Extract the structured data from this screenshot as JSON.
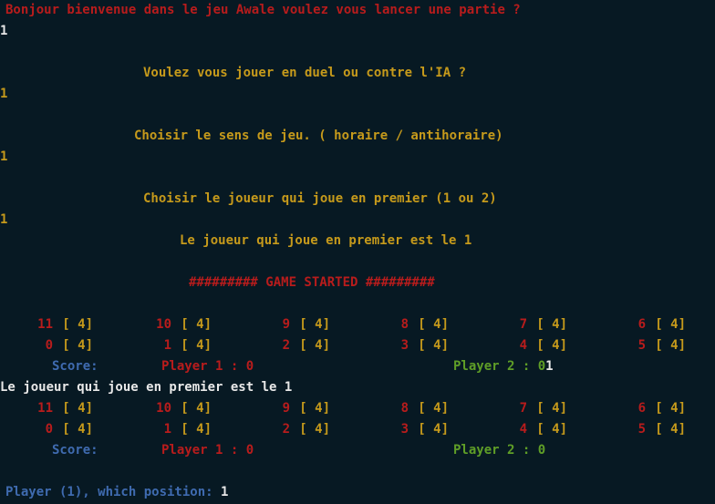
{
  "colors": {
    "background": "#071923",
    "red": "#b81c1c",
    "gold": "#c69a1b",
    "white": "#e8e8e8",
    "blue": "#3f6bb0",
    "green": "#5f9e27"
  },
  "intro": {
    "welcome_question": "Bonjour bienvenue dans le jeu Awale voulez vous lancer une partie ?",
    "welcome_answer": "1",
    "mode_question": "Voulez vous jouer en duel ou contre l'IA ?",
    "mode_answer": "1",
    "direction_question": "Choisir le sens de jeu. ( horaire / antihoraire)",
    "direction_answer": "1",
    "first_player_question": "Choisir le joueur qui joue en premier (1 ou 2)",
    "first_player_answer": "1",
    "first_player_result": "Le joueur qui joue en premier est le 1",
    "game_started": "######### GAME STARTED #########"
  },
  "board1": {
    "top": [
      {
        "pos": "11",
        "seeds": "[ 4]"
      },
      {
        "pos": "10",
        "seeds": "[ 4]"
      },
      {
        "pos": "9",
        "seeds": "[ 4]"
      },
      {
        "pos": "8",
        "seeds": "[ 4]"
      },
      {
        "pos": "7",
        "seeds": "[ 4]"
      },
      {
        "pos": "6",
        "seeds": "[ 4]"
      }
    ],
    "bottom": [
      {
        "pos": "0",
        "seeds": "[ 4]"
      },
      {
        "pos": "1",
        "seeds": "[ 4]"
      },
      {
        "pos": "2",
        "seeds": "[ 4]"
      },
      {
        "pos": "3",
        "seeds": "[ 4]"
      },
      {
        "pos": "4",
        "seeds": "[ 4]"
      },
      {
        "pos": "5",
        "seeds": "[ 4]"
      }
    ],
    "score_label": "Score:",
    "player1_score": "Player 1 : 0",
    "player2_score": "Player 2 : 0",
    "typed_input": "1"
  },
  "turn_message": "Le joueur qui joue en premier est le 1",
  "board2": {
    "top": [
      {
        "pos": "11",
        "seeds": "[ 4]"
      },
      {
        "pos": "10",
        "seeds": "[ 4]"
      },
      {
        "pos": "9",
        "seeds": "[ 4]"
      },
      {
        "pos": "8",
        "seeds": "[ 4]"
      },
      {
        "pos": "7",
        "seeds": "[ 4]"
      },
      {
        "pos": "6",
        "seeds": "[ 4]"
      }
    ],
    "bottom": [
      {
        "pos": "0",
        "seeds": "[ 4]"
      },
      {
        "pos": "1",
        "seeds": "[ 4]"
      },
      {
        "pos": "2",
        "seeds": "[ 4]"
      },
      {
        "pos": "3",
        "seeds": "[ 4]"
      },
      {
        "pos": "4",
        "seeds": "[ 4]"
      },
      {
        "pos": "5",
        "seeds": "[ 4]"
      }
    ],
    "score_label": "Score:",
    "player1_score": "Player 1 : 0",
    "player2_score": "Player 2 : 0"
  },
  "prompt": {
    "label": "Player (1), which position:",
    "value": "1"
  }
}
